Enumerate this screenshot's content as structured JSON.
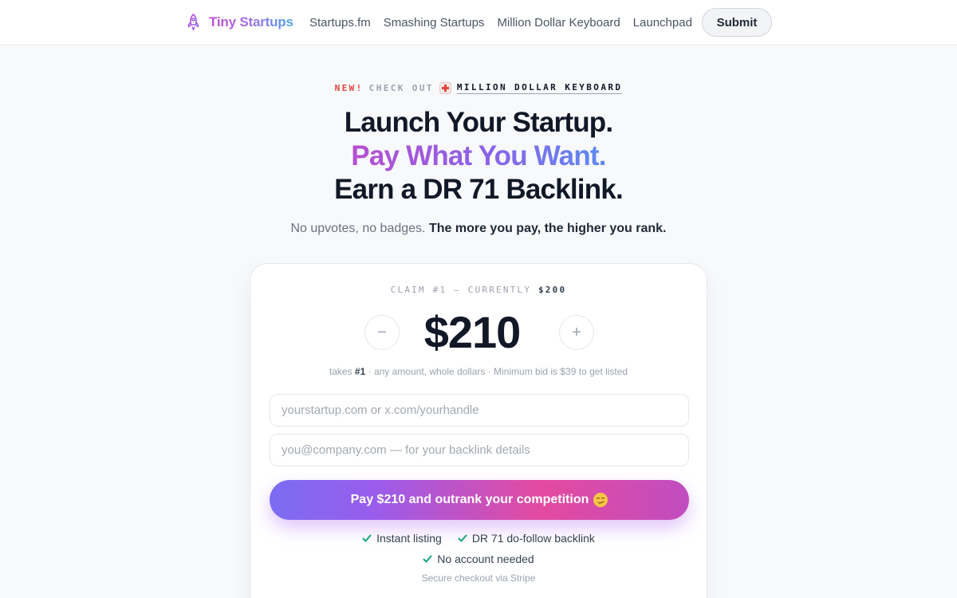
{
  "header": {
    "brand": "Tiny Startups",
    "nav": [
      "Startups.fm",
      "Smashing Startups",
      "Million Dollar Keyboard",
      "Launchpad"
    ],
    "submit_label": "Submit"
  },
  "announcement": {
    "new": "NEW!",
    "check_out": "CHECK OUT",
    "link": "MILLION DOLLAR KEYBOARD"
  },
  "hero": {
    "line1": "Launch Your Startup.",
    "line2": "Pay What You Want.",
    "line3": "Earn a DR 71 Backlink.",
    "subtitle_plain": "No upvotes, no badges.",
    "subtitle_bold": "The more you pay, the higher you rank."
  },
  "card": {
    "claim_prefix": "CLAIM #1 — CURRENTLY",
    "claim_current": "$200",
    "price": "$210",
    "minus": "−",
    "plus": "+",
    "hint_takes": "takes",
    "hint_rank": "#1",
    "hint_rest": "· any amount, whole dollars · Minimum bid is $39 to get listed",
    "url_placeholder": "yourstartup.com or x.com/yourhandle",
    "email_placeholder": "you@company.com — for your backlink details",
    "pay_label": "Pay $210 and outrank your competition",
    "features": [
      "Instant listing",
      "DR 71 do-follow backlink",
      "No account needed"
    ],
    "secure": "Secure checkout via Stripe"
  },
  "colors": {
    "accent_red": "#e0473a",
    "check_green": "#16a37f",
    "brand_gradient_start": "#c04bd6",
    "brand_gradient_end": "#4aa6f0"
  },
  "icons": [
    "rocket-icon",
    "keyboard-badge-icon",
    "check-icon",
    "smirk-emoji-icon"
  ]
}
